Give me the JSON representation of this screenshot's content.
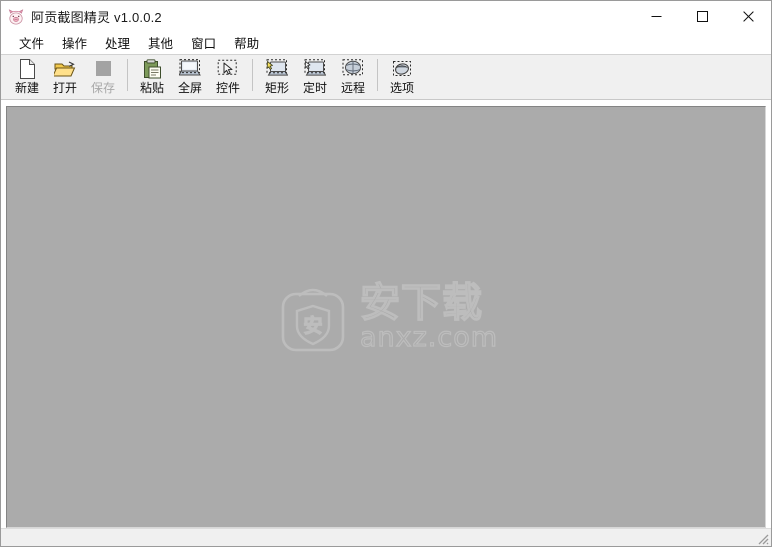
{
  "window": {
    "title": "阿贡截图精灵 v1.0.0.2",
    "app_icon": "pig-mascot-icon",
    "canvas_color": "#ababab",
    "toolbar_color": "#f0f0f0",
    "accent_close_color": "#e81123"
  },
  "window_controls": [
    {
      "name": "minimize-button",
      "icon": "minimize-icon",
      "label": "—"
    },
    {
      "name": "maximize-button",
      "icon": "maximize-icon",
      "label": "□"
    },
    {
      "name": "close-button",
      "icon": "close-icon",
      "label": "✕"
    }
  ],
  "menubar": {
    "items": [
      {
        "label": "文件"
      },
      {
        "label": "操作"
      },
      {
        "label": "处理"
      },
      {
        "label": "其他"
      },
      {
        "label": "窗口"
      },
      {
        "label": "帮助"
      }
    ]
  },
  "toolbar": {
    "groups": [
      {
        "buttons": [
          {
            "label": "新建",
            "icon": "new-page-icon",
            "enabled": true
          },
          {
            "label": "打开",
            "icon": "open-folder-icon",
            "enabled": true
          },
          {
            "label": "保存",
            "icon": "save-disk-icon",
            "enabled": false
          }
        ]
      },
      {
        "buttons": [
          {
            "label": "粘贴",
            "icon": "paste-clipboard-icon",
            "enabled": true
          },
          {
            "label": "全屏",
            "icon": "fullscreen-capture-icon",
            "enabled": true
          },
          {
            "label": "控件",
            "icon": "control-capture-icon",
            "enabled": true
          }
        ]
      },
      {
        "buttons": [
          {
            "label": "矩形",
            "icon": "rectangle-capture-icon",
            "enabled": true
          },
          {
            "label": "定时",
            "icon": "timer-capture-icon",
            "enabled": true
          },
          {
            "label": "远程",
            "icon": "remote-capture-icon",
            "enabled": true
          }
        ]
      },
      {
        "buttons": [
          {
            "label": "选项",
            "icon": "options-icon",
            "enabled": true
          }
        ]
      }
    ]
  },
  "canvas": {
    "watermark": {
      "logo_icon": "anxz-shield-bag-logo",
      "shield_text": "安",
      "cn_text": "安下载",
      "en_text": "anxz.com"
    }
  },
  "statusbar": {
    "resize_grip": "resize-grip-icon"
  }
}
